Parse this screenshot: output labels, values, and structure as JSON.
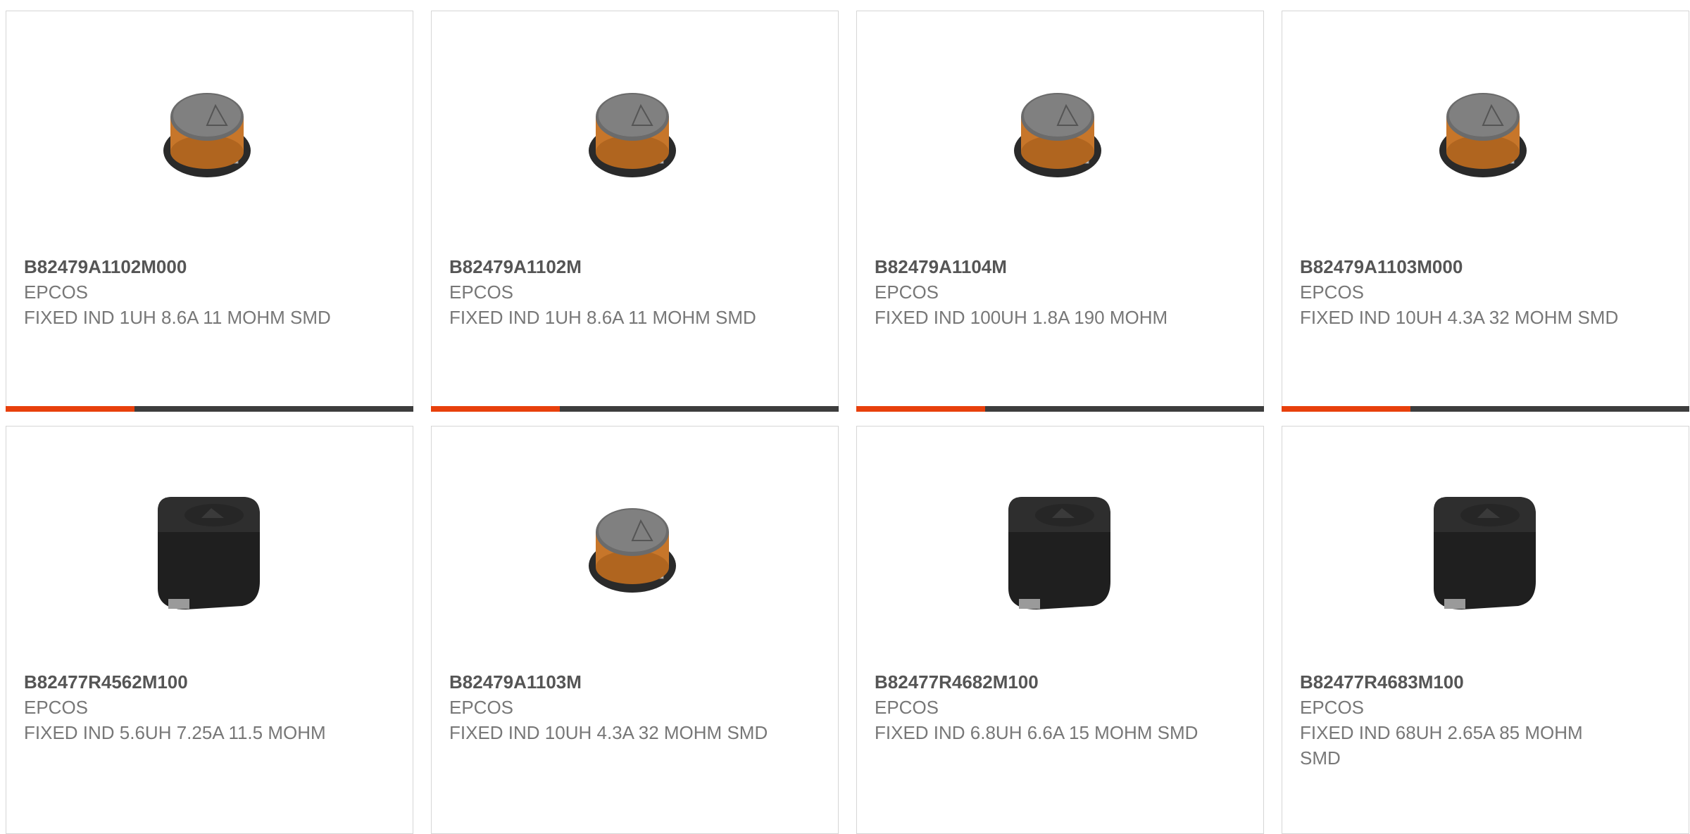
{
  "products": [
    {
      "part": "B82479A1102M000",
      "mfr": "EPCOS",
      "desc": "FIXED IND 1UH 8.6A 11 MOHM SMD",
      "img": "round-inductor"
    },
    {
      "part": "B82479A1102M",
      "mfr": "EPCOS",
      "desc": "FIXED IND 1UH 8.6A 11 MOHM SMD",
      "img": "round-inductor"
    },
    {
      "part": "B82479A1104M",
      "mfr": "EPCOS",
      "desc": "FIXED IND 100UH 1.8A 190 MOHM",
      "img": "round-inductor"
    },
    {
      "part": "B82479A1103M000",
      "mfr": "EPCOS",
      "desc": "FIXED IND 10UH 4.3A 32 MOHM SMD",
      "img": "round-inductor"
    },
    {
      "part": "B82477R4562M100",
      "mfr": "EPCOS",
      "desc": "FIXED IND 5.6UH 7.25A 11.5 MOHM",
      "img": "square-inductor"
    },
    {
      "part": "B82479A1103M",
      "mfr": "EPCOS",
      "desc": "FIXED IND 10UH 4.3A 32 MOHM SMD",
      "img": "round-inductor"
    },
    {
      "part": "B82477R4682M100",
      "mfr": "EPCOS",
      "desc": "FIXED IND 6.8UH 6.6A 15 MOHM SMD",
      "img": "square-inductor"
    },
    {
      "part": "B82477R4683M100",
      "mfr": "EPCOS",
      "desc": "FIXED IND 68UH 2.65A 85 MOHM SMD",
      "img": "square-inductor"
    }
  ],
  "colors": {
    "accent": "#e8400c",
    "bar": "#3d3d3d"
  }
}
